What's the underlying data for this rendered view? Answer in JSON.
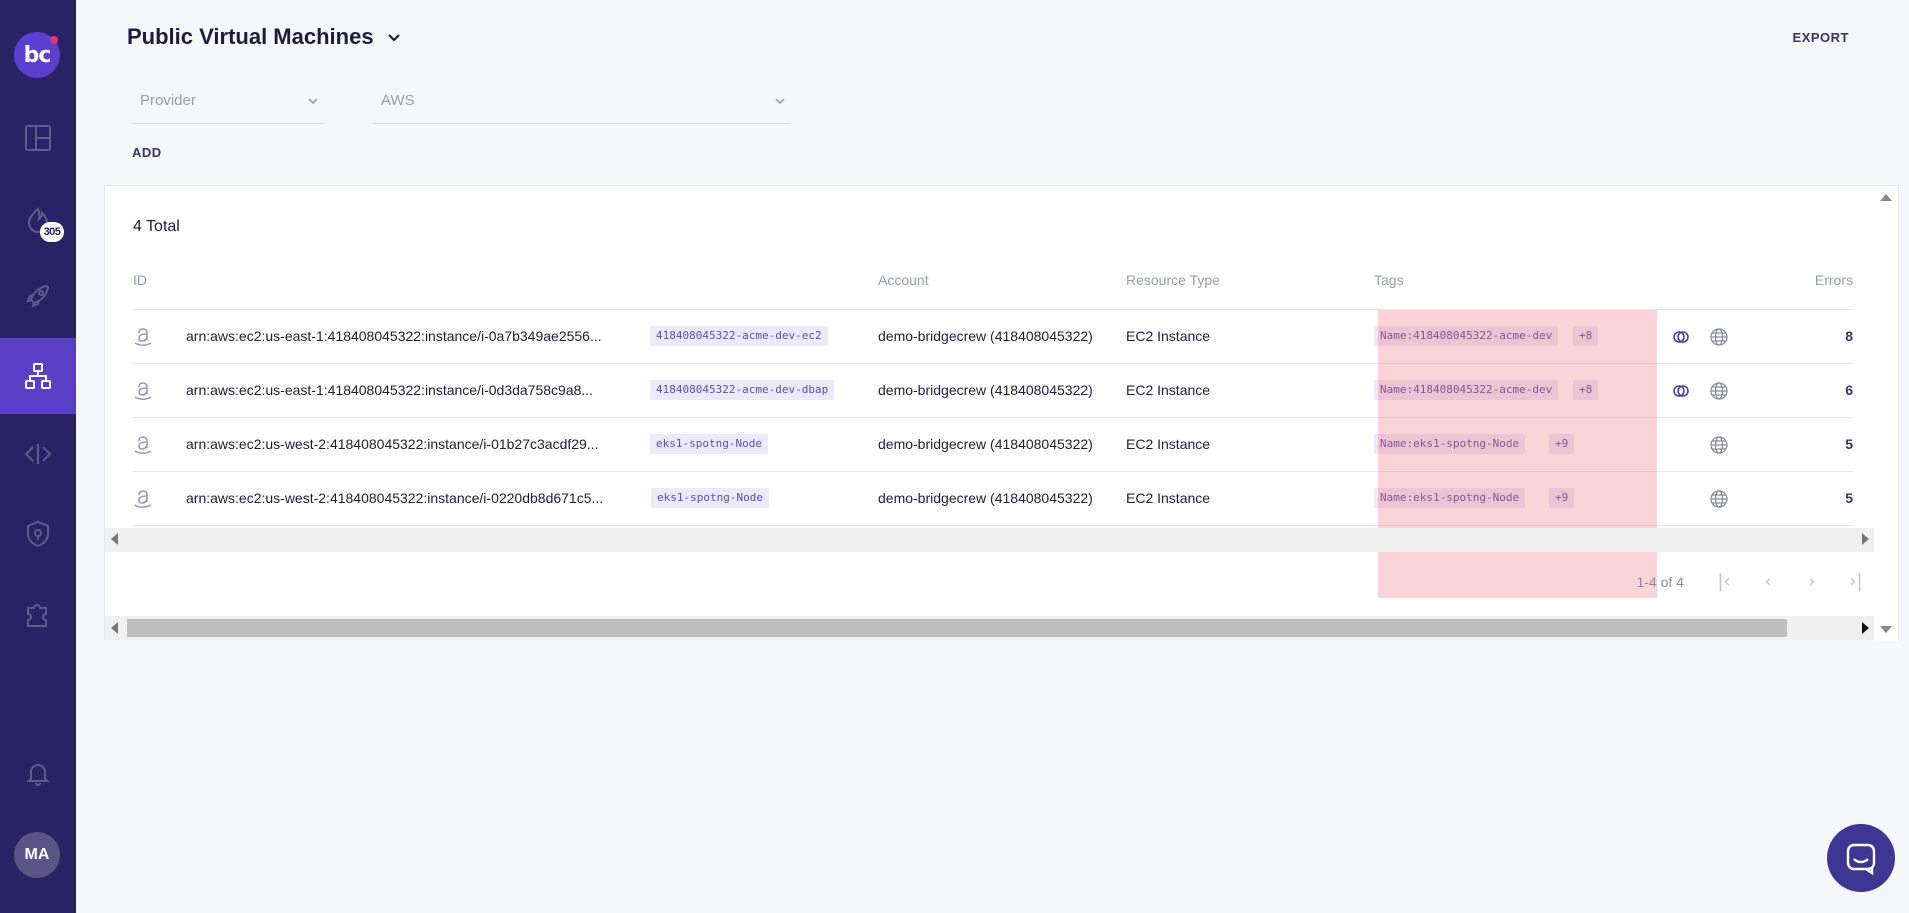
{
  "app": {
    "logo": "bc"
  },
  "sidebar": {
    "items": [
      {
        "name": "dashboard-icon"
      },
      {
        "name": "incidents-icon",
        "badge": "305"
      },
      {
        "name": "rocket-icon"
      },
      {
        "name": "inventory-icon",
        "active": true
      },
      {
        "name": "code-icon"
      },
      {
        "name": "shield-icon"
      },
      {
        "name": "integrations-icon"
      }
    ],
    "bell": "bell-icon",
    "avatar": "MA"
  },
  "header": {
    "title": "Public Virtual Machines",
    "export_label": "EXPORT"
  },
  "filters": {
    "provider_placeholder": "Provider",
    "provider_value": "AWS",
    "add_label": "ADD"
  },
  "table": {
    "total": "4 Total",
    "columns": {
      "id": "ID",
      "account": "Account",
      "resource_type": "Resource Type",
      "tags": "Tags",
      "errors": "Errors"
    },
    "rows": [
      {
        "id": "arn:aws:ec2:us-east-1:418408045322:instance/i-0a7b349ae2556...",
        "name_chip": "418408045322-acme-dev-ec2",
        "account": "demo-bridgecrew (418408045322)",
        "resource_type": "EC2 Instance",
        "tag": "Name:418408045322-acme-dev",
        "tag_more": "+8",
        "has_link_icon": true,
        "errors": "8"
      },
      {
        "id": "arn:aws:ec2:us-east-1:418408045322:instance/i-0d3da758c9a8...",
        "name_chip": "418408045322-acme-dev-dbap",
        "account": "demo-bridgecrew (418408045322)",
        "resource_type": "EC2 Instance",
        "tag": "Name:418408045322-acme-dev",
        "tag_more": "+8",
        "has_link_icon": true,
        "errors": "6"
      },
      {
        "id": "arn:aws:ec2:us-west-2:418408045322:instance/i-01b27c3acdf29...",
        "name_chip": "eks1-spotng-Node",
        "account": "demo-bridgecrew (418408045322)",
        "resource_type": "EC2 Instance",
        "tag": "Name:eks1-spotng-Node",
        "tag_more": "+9",
        "has_link_icon": false,
        "errors": "5"
      },
      {
        "id": "arn:aws:ec2:us-west-2:418408045322:instance/i-0220db8d671c5...",
        "name_chip": "eks1-spotng-Node",
        "account": "demo-bridgecrew (418408045322)",
        "resource_type": "EC2 Instance",
        "tag": "Name:eks1-spotng-Node",
        "tag_more": "+9",
        "has_link_icon": false,
        "errors": "5"
      }
    ]
  },
  "pager": {
    "range": "1-4 of 4"
  },
  "colors": {
    "sidebar": "#2a2264",
    "active": "#5a3fc7",
    "accent": "#3f3592",
    "chip_bg": "#ece9fb",
    "highlight": "#f5646e"
  }
}
